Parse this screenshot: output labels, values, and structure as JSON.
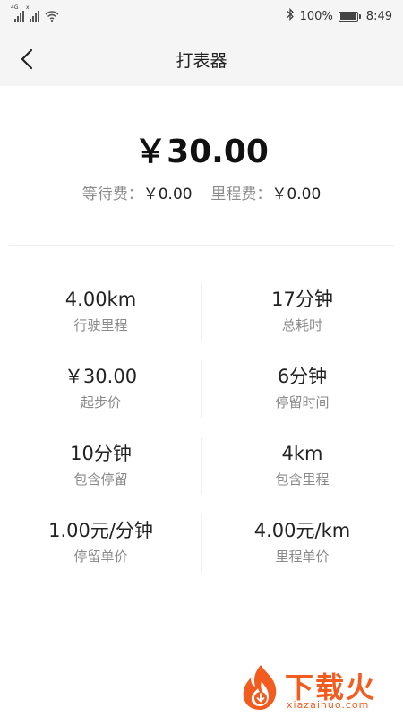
{
  "status_bar": {
    "signal1_tag": "4G",
    "signal2_tag": "x",
    "battery_text": "100%",
    "time": "8:49"
  },
  "header": {
    "title": "打表器"
  },
  "fare": {
    "total": "￥30.00",
    "waiting_label": "等待费：",
    "waiting_value": "￥0.00",
    "mileage_label": "里程费：",
    "mileage_value": "￥0.00"
  },
  "stats": [
    {
      "value": "4.00km",
      "label": "行驶里程"
    },
    {
      "value": "17分钟",
      "label": "总耗时"
    },
    {
      "value": "￥30.00",
      "label": "起步价"
    },
    {
      "value": "6分钟",
      "label": "停留时间"
    },
    {
      "value": "10分钟",
      "label": "包含停留"
    },
    {
      "value": "4km",
      "label": "包含里程"
    },
    {
      "value": "1.00元/分钟",
      "label": "停留单价"
    },
    {
      "value": "4.00元/km",
      "label": "里程单价"
    }
  ],
  "watermark": {
    "title": "下载火",
    "url": "xiazaihuo.com"
  },
  "colors": {
    "header_bg": "#f5f5f5",
    "muted_text": "#8a8a8a",
    "watermark": "#f25c1f"
  }
}
